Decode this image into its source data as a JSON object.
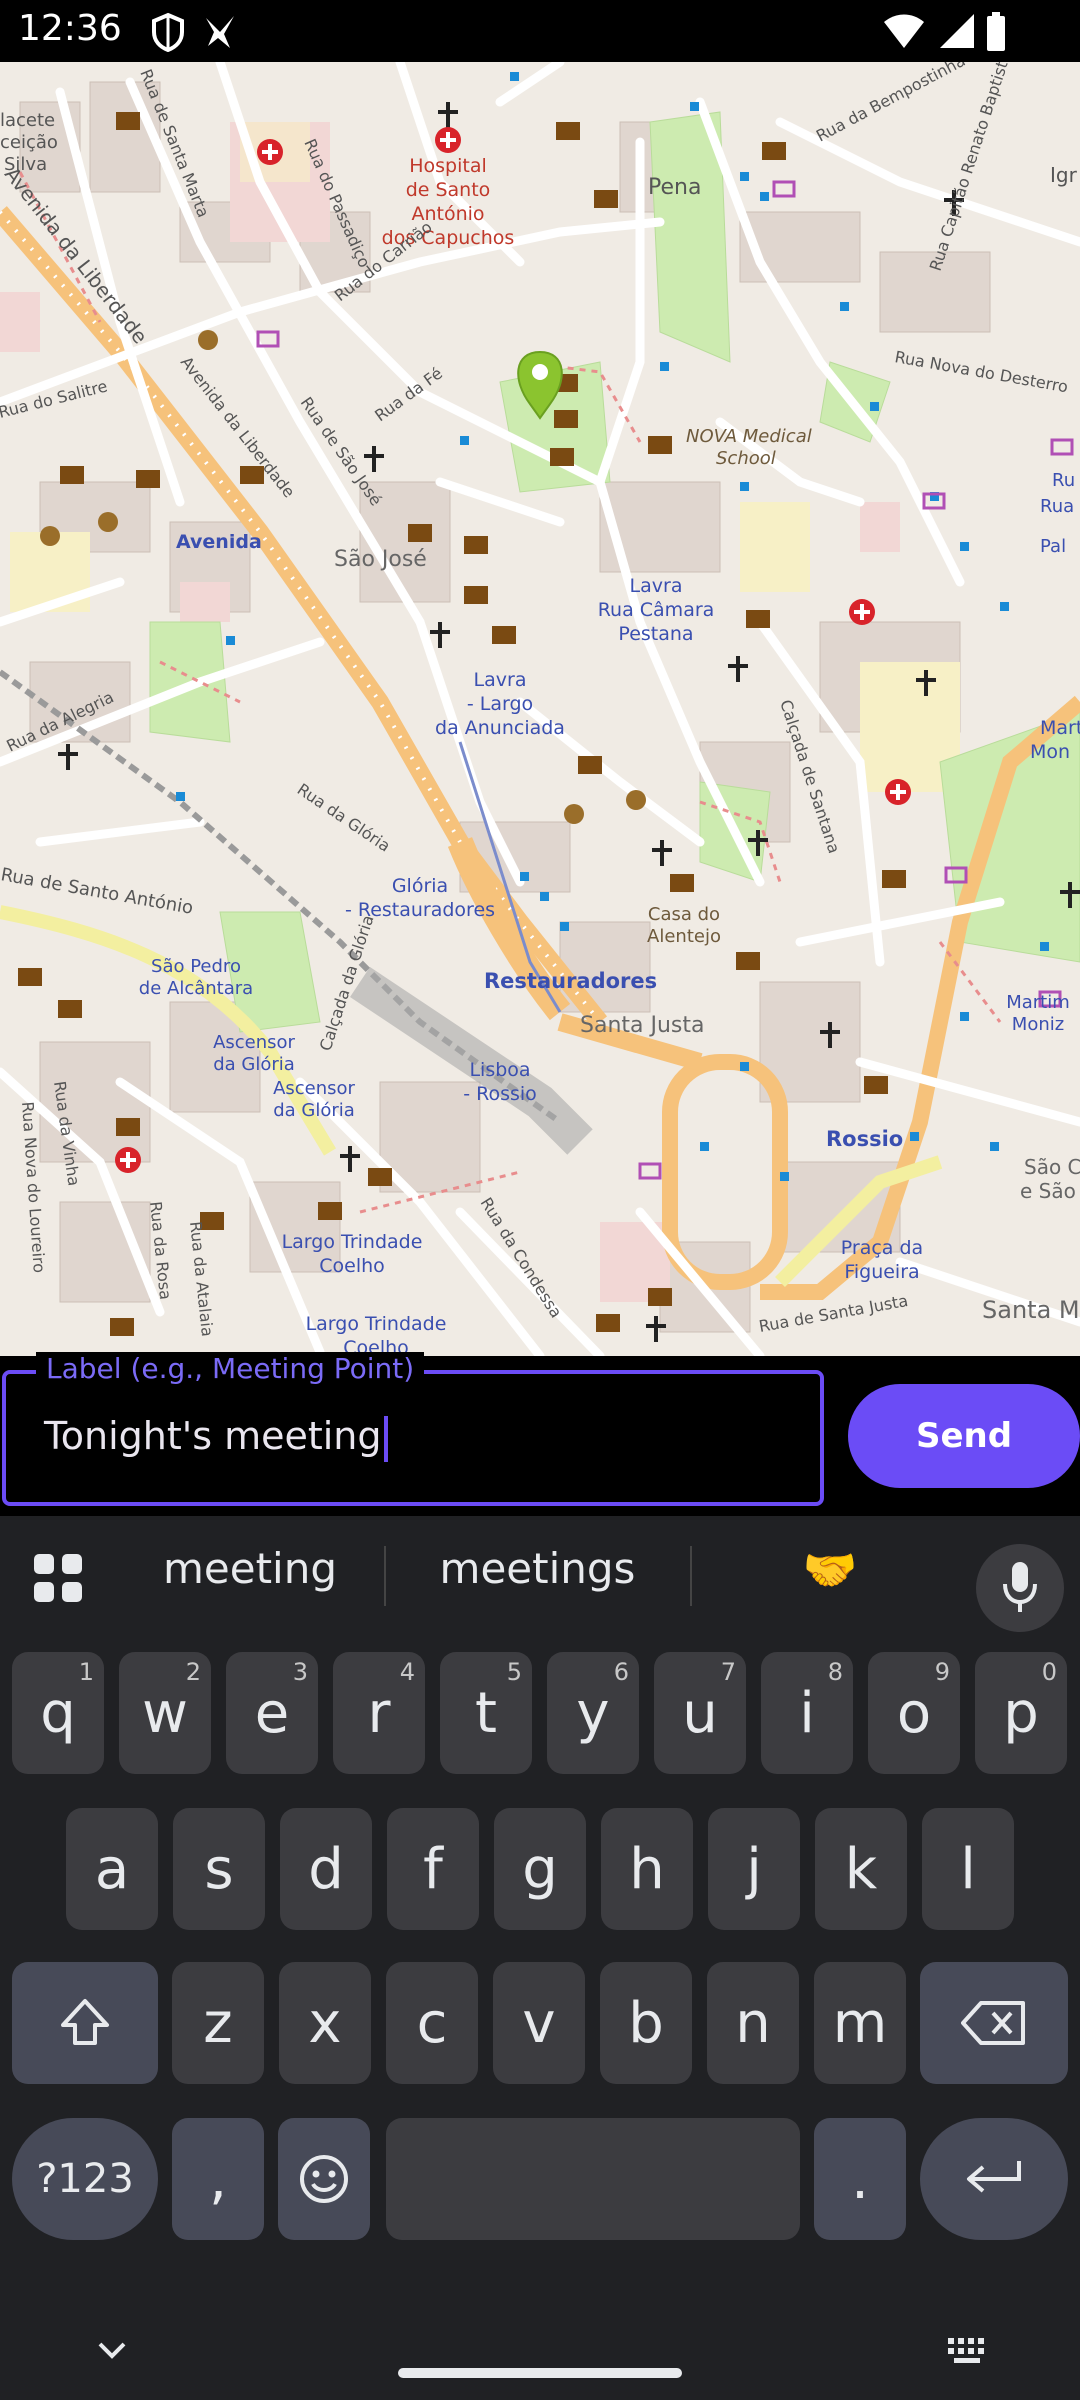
{
  "status_bar": {
    "time": "12:36",
    "icons": [
      "shield-icon",
      "bird-icon",
      "wifi-icon",
      "signal-icon",
      "battery-icon"
    ]
  },
  "map": {
    "labels": {
      "avenida_liberdade": "Avenida da Liberdade",
      "avenida_liberdade2": "Avenida da Liberdade",
      "rua_santa_marta": "Rua de Santa Marta",
      "rua_passadico": "Rua do Passadiço",
      "hospital": "Hospital de Santo António dos Capuchos",
      "pena": "Pena",
      "rua_bempostinha": "Rua da Bempostinha",
      "rua_capitao_renato": "Rua Capitão Renato Baptista",
      "rua_carrião": "Rua do Carrião",
      "rua_fe": "Rua da Fé",
      "rua_sao_jose": "Rua de São José",
      "rua_nova_desterro": "Rua Nova do Desterro",
      "rua_salitre": "Rua do Salitre",
      "nova_medical": "NOVA Medical School",
      "avenida": "Avenida",
      "sao_jose": "São José",
      "lavra_camara": "Lavra - Rua Câmara Pestana",
      "lavra_largo": "Lavra - Largo da Anunciada",
      "rua_alegria": "Rua da Alegria",
      "calcada_santana": "Calçada de Santana",
      "rua_gloria": "Rua da Glória",
      "gloria_rest": "Glória - Restauradores",
      "restauradores": "Restauradores",
      "santo_antonio": "Rua de Santo António",
      "sao_pedro": "São Pedro de Alcântara",
      "casa_alentejo": "Casa do Alentejo",
      "santa_justa": "Santa Justa",
      "martim_moniz": "Martim Moniz",
      "calcada_gloria": "Calçada da Glória",
      "ascensor_gloria": "Ascensor da Glória",
      "ascensor_gloria2": "Ascensor da Glória",
      "lisboa_rossio": "Lisboa - Rossio",
      "rossio": "Rossio",
      "rua_vinha": "Rua da Vinha",
      "rua_nova_loureiro": "Rua Nova do Loureiro",
      "rua_rosa": "Rua da Rosa",
      "rua_atalaia": "Rua da Atalaia",
      "largo_trindade": "Largo Trindade Coelho",
      "largo_trindade2": "Largo Trindade Coelho",
      "rua_condessa": "Rua da Condessa",
      "praca_figueira": "Praça da Figueira",
      "rua_santa_justa": "Rua de Santa Justa",
      "santa_cruz": "Santa Maria",
      "sao_c": "São C",
      "de_sao": "e São",
      "mart": "Marti",
      "mon": "Mon",
      "igr": "Igr",
      "rua_frag": "Ru",
      "rua_frag2": "Rua",
      "pal": "Pal",
      "lacete": "lacete",
      "ceicao": "ceição",
      "silva": "Silva"
    }
  },
  "input": {
    "label": "Label (e.g., Meeting Point)",
    "value": "Tonight's meeting"
  },
  "send_button": {
    "label": "Send"
  },
  "keyboard": {
    "suggestions": [
      "meeting",
      "meetings"
    ],
    "emoji_suggestion": "🤝",
    "row1": [
      {
        "k": "q",
        "h": "1"
      },
      {
        "k": "w",
        "h": "2"
      },
      {
        "k": "e",
        "h": "3"
      },
      {
        "k": "r",
        "h": "4"
      },
      {
        "k": "t",
        "h": "5"
      },
      {
        "k": "y",
        "h": "6"
      },
      {
        "k": "u",
        "h": "7"
      },
      {
        "k": "i",
        "h": "8"
      },
      {
        "k": "o",
        "h": "9"
      },
      {
        "k": "p",
        "h": "0"
      }
    ],
    "row2": [
      "a",
      "s",
      "d",
      "f",
      "g",
      "h",
      "j",
      "k",
      "l"
    ],
    "row3": [
      "z",
      "x",
      "c",
      "v",
      "b",
      "n",
      "m"
    ],
    "symbols_label": "?123",
    "comma": ",",
    "period": "."
  }
}
